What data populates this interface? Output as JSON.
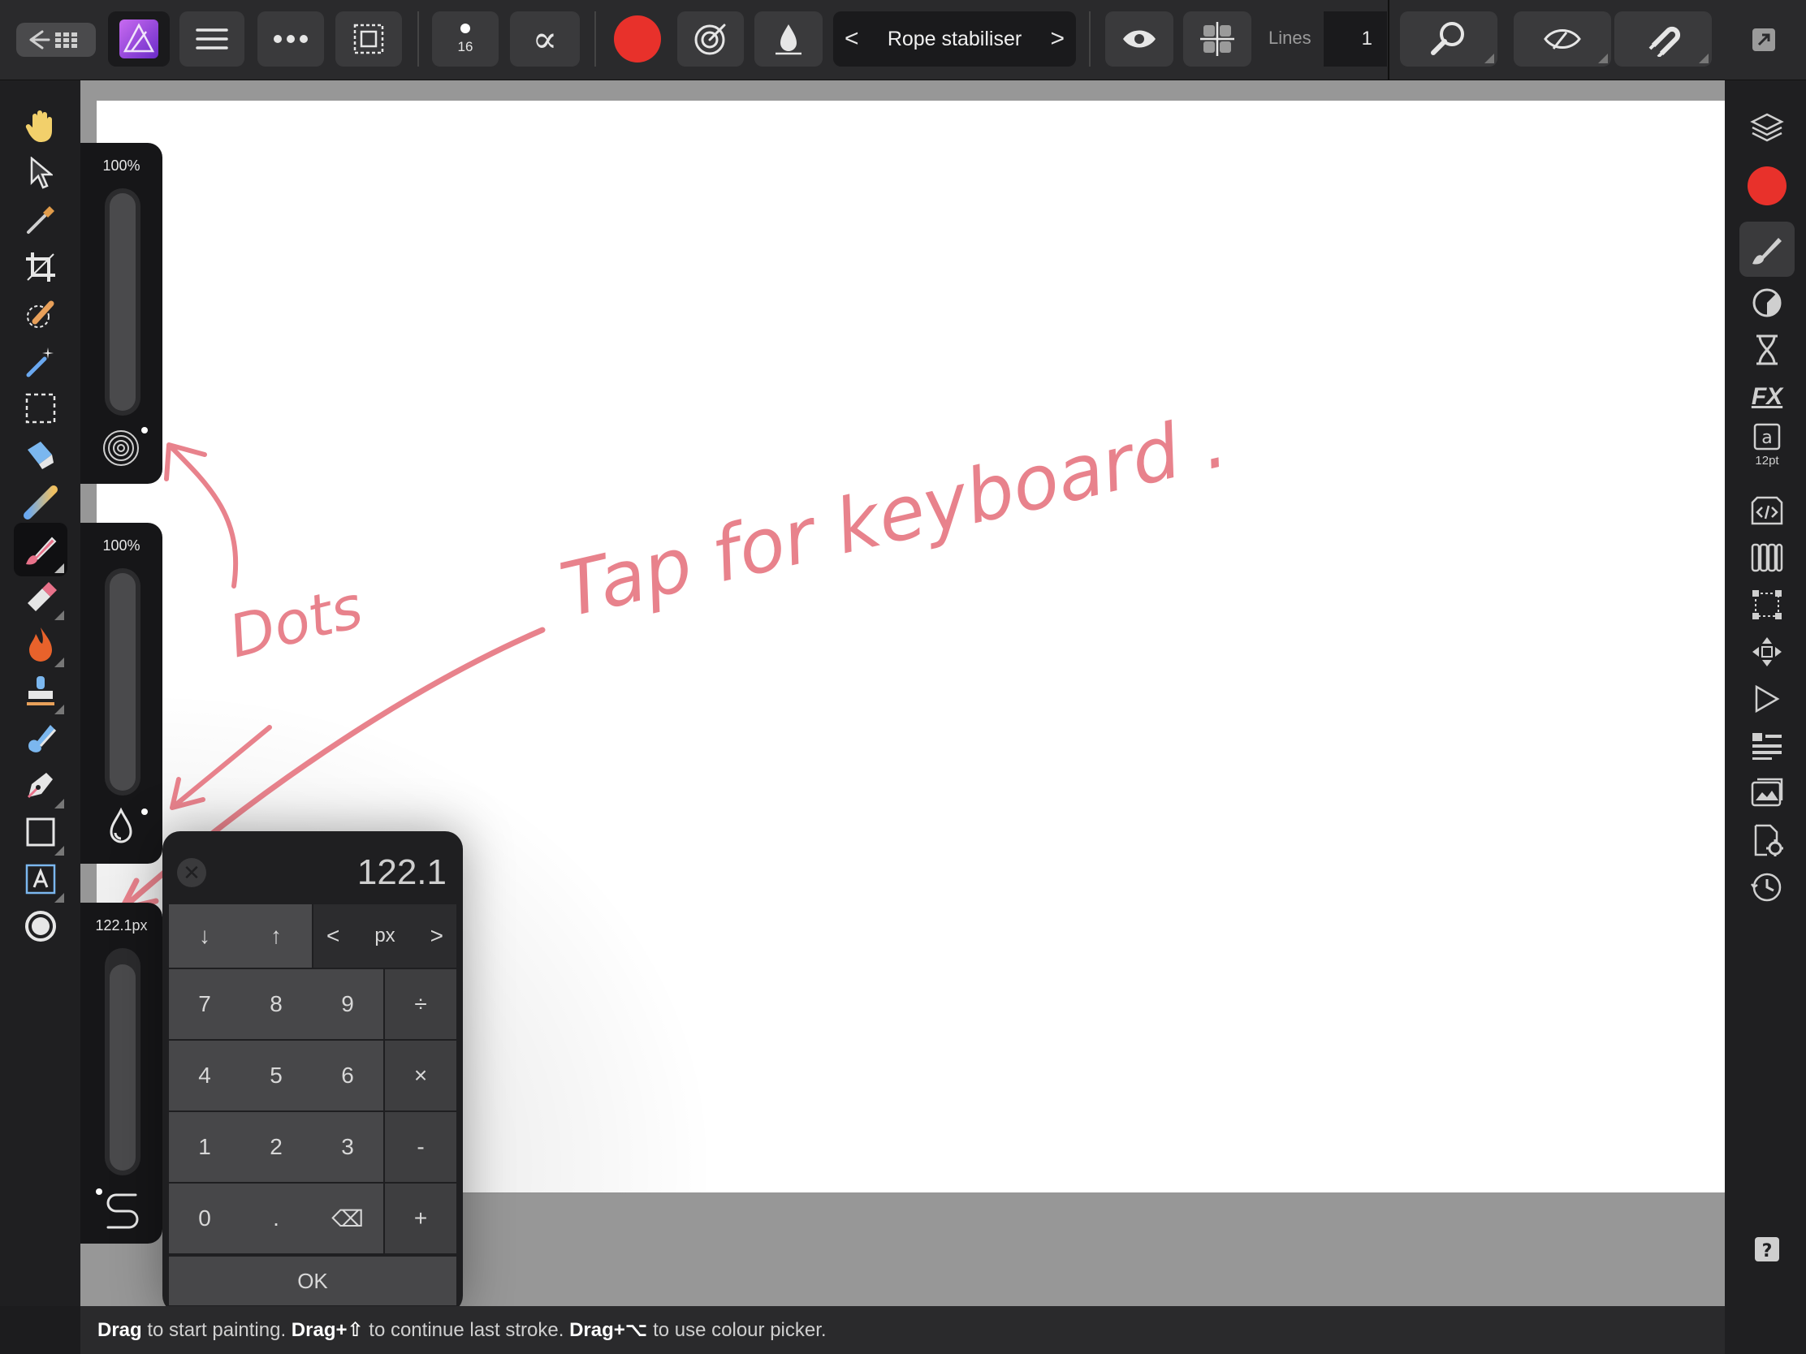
{
  "toolbar": {
    "brush_size": "16",
    "primary_color": "#e8312b",
    "stabiliser_mode": "Rope stabiliser",
    "lines_label": "Lines",
    "lines_value": "1"
  },
  "left_panels": {
    "opacity_label": "100%",
    "opacity_level": 1.0,
    "flow_label": "100%",
    "flow_level": 1.0,
    "width_label": "122.1px"
  },
  "keypad": {
    "display_value": "122.1",
    "unit": "px",
    "keys_row1": [
      "7",
      "8",
      "9",
      "÷"
    ],
    "keys_row2": [
      "4",
      "5",
      "6",
      "×"
    ],
    "keys_row3": [
      "1",
      "2",
      "3",
      "-"
    ],
    "keys_row4": [
      "0",
      ".",
      "⌫",
      "+"
    ],
    "ok_label": "OK"
  },
  "right_studio": {
    "color_swatch": "#e8312b",
    "text_size": "12pt"
  },
  "annotations": {
    "handwriting_1": "Dots",
    "handwriting_2": "Tap for keyboard .",
    "stroke_color": "#e8828c"
  },
  "status": {
    "w1": "Drag",
    "t1": " to start painting. ",
    "w2": "Drag+⇧",
    "t2": " to continue last stroke. ",
    "w3": "Drag+⌥",
    "t3": " to use colour picker."
  }
}
